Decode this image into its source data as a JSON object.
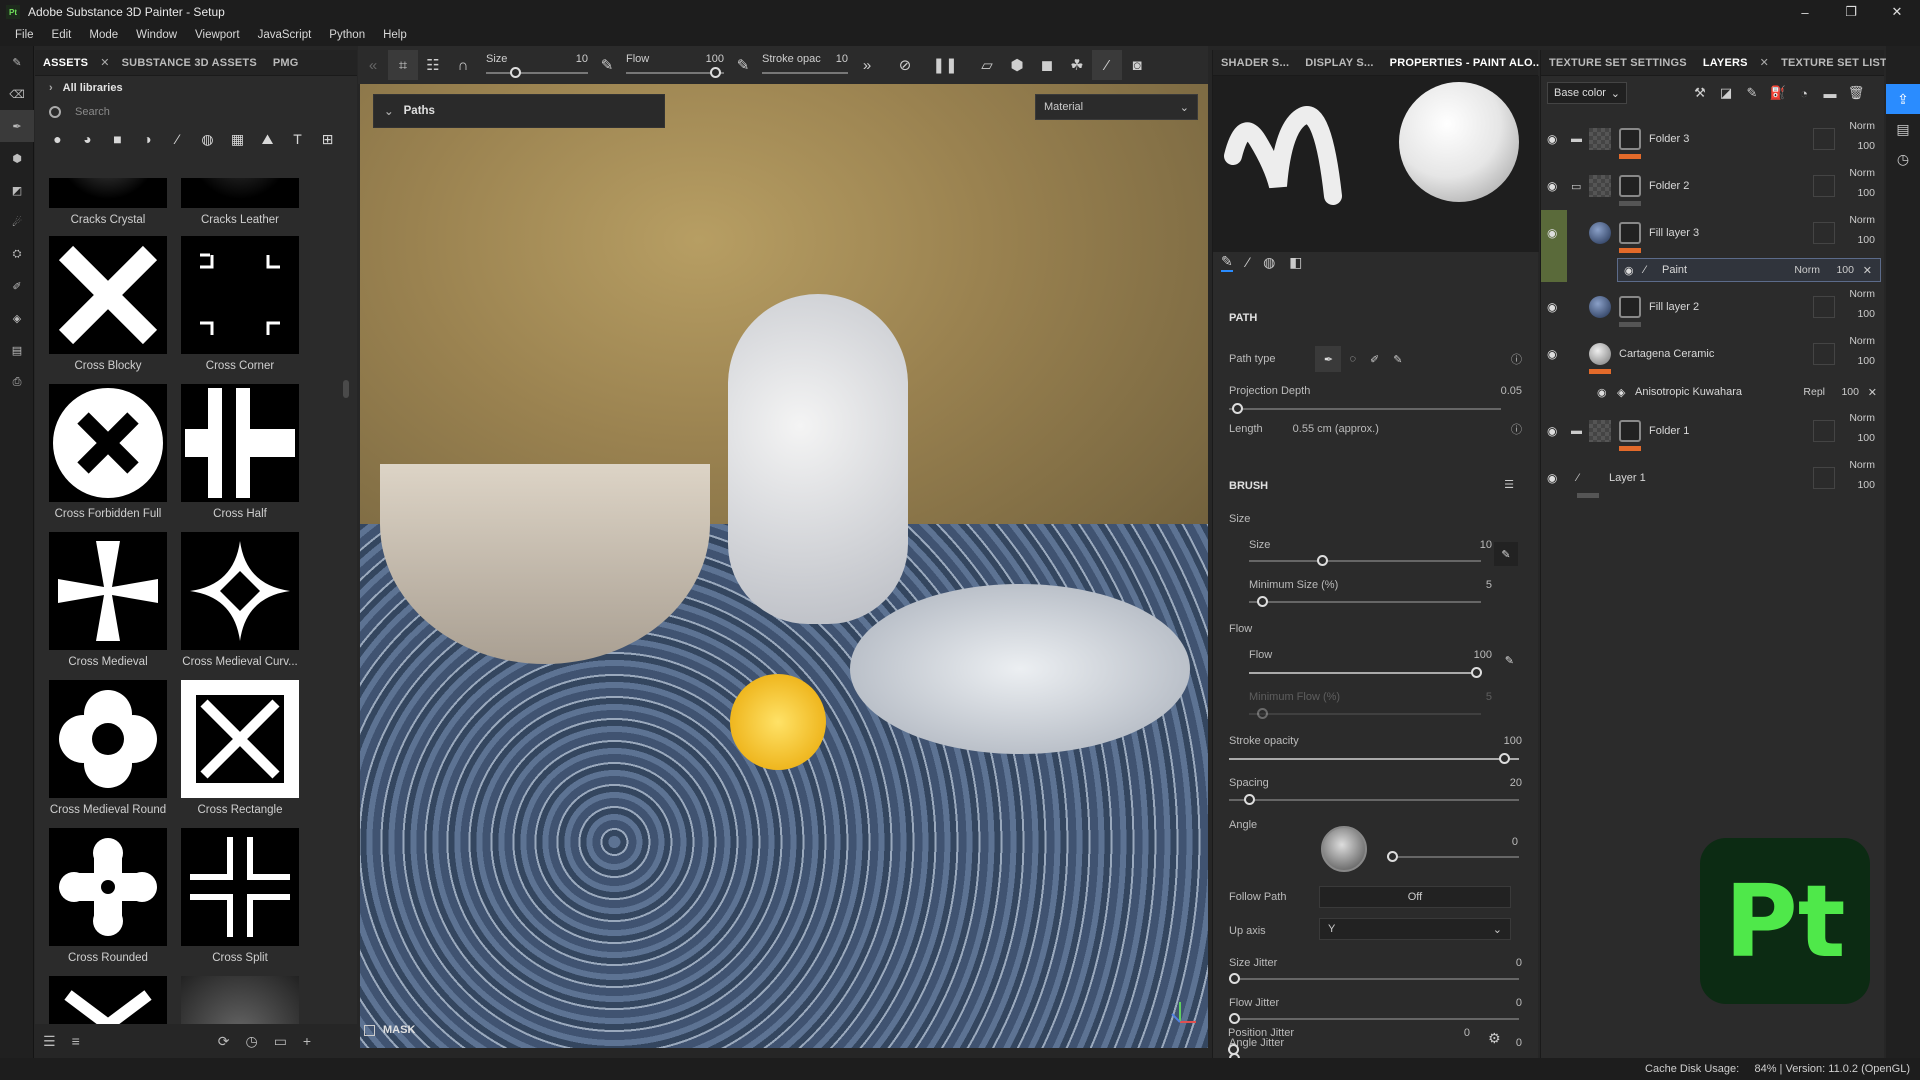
{
  "app": {
    "title": "Adobe Substance 3D Painter - Setup"
  },
  "window_controls": [
    "–",
    "❐",
    "✕"
  ],
  "menu": [
    "File",
    "Edit",
    "Mode",
    "Window",
    "Viewport",
    "JavaScript",
    "Python",
    "Help"
  ],
  "assets": {
    "tabs": [
      "ASSETS",
      "SUBSTANCE 3D ASSETS",
      "PMG"
    ],
    "library": "All libraries",
    "search_placeholder": "Search",
    "tiles": [
      {
        "label": "Cracks Crystal"
      },
      {
        "label": "Cracks Leather"
      },
      {
        "label": "Cross Blocky"
      },
      {
        "label": "Cross Corner"
      },
      {
        "label": "Cross Forbidden Full"
      },
      {
        "label": "Cross Half"
      },
      {
        "label": "Cross Medieval"
      },
      {
        "label": "Cross Medieval Curv..."
      },
      {
        "label": "Cross Medieval Round"
      },
      {
        "label": "Cross Rectangle"
      },
      {
        "label": "Cross Rounded"
      },
      {
        "label": "Cross Split"
      }
    ]
  },
  "viewport_toolbar": {
    "size": {
      "label": "Size",
      "value": "10"
    },
    "flow": {
      "label": "Flow",
      "value": "100"
    },
    "stroke": {
      "label": "Stroke opac",
      "value": "10"
    }
  },
  "viewport": {
    "paths_label": "Paths",
    "material_label": "Material",
    "mask_label": "MASK"
  },
  "properties": {
    "tabs": [
      "SHADER S...",
      "DISPLAY S...",
      "PROPERTIES - PAINT ALO..."
    ],
    "path_section": "PATH",
    "path_type_label": "Path type",
    "projection_depth": {
      "label": "Projection Depth",
      "value": "0.05",
      "fraction": 0.05
    },
    "length": {
      "label": "Length",
      "value": "0.55 cm (approx.)"
    },
    "brush_section": "BRUSH",
    "size_group": "Size",
    "size": {
      "label": "Size",
      "value": "10",
      "fraction": 0.32
    },
    "min_size": {
      "label": "Minimum Size (%)",
      "value": "5",
      "fraction": 0.05
    },
    "flow_group": "Flow",
    "flow": {
      "label": "Flow",
      "value": "100",
      "fraction": 1.0
    },
    "min_flow": {
      "label": "Minimum Flow (%)",
      "value": "5"
    },
    "stroke_opacity": {
      "label": "Stroke opacity",
      "value": "100",
      "fraction": 1.0
    },
    "spacing": {
      "label": "Spacing",
      "value": "20",
      "fraction": 0.06
    },
    "angle": {
      "label": "Angle",
      "value": "0"
    },
    "follow_path": {
      "label": "Follow Path",
      "value": "Off"
    },
    "up_axis": {
      "label": "Up axis",
      "value": "Y"
    },
    "size_jitter": {
      "label": "Size Jitter",
      "value": "0"
    },
    "flow_jitter": {
      "label": "Flow Jitter",
      "value": "0"
    },
    "angle_jitter": {
      "label": "Angle Jitter",
      "value": "0"
    },
    "position_jitter": {
      "label": "Position Jitter",
      "value": "0"
    }
  },
  "layers_panel": {
    "tabs": [
      "TEXTURE SET SETTINGS",
      "LAYERS",
      "TEXTURE SET LIST"
    ],
    "channel": "Base color",
    "layers": [
      {
        "name": "Folder 3",
        "blend": "Norm",
        "opacity": "100"
      },
      {
        "name": "Folder 2",
        "blend": "Norm",
        "opacity": "100"
      },
      {
        "name": "Fill layer 3",
        "blend": "Norm",
        "opacity": "100"
      },
      {
        "name": "Paint",
        "blend": "Norm",
        "opacity": "100"
      },
      {
        "name": "Fill layer 2",
        "blend": "Norm",
        "opacity": "100"
      },
      {
        "name": "Cartagena Ceramic",
        "blend": "Norm",
        "opacity": "100"
      },
      {
        "name": "Anisotropic Kuwahara",
        "blend": "Repl",
        "opacity": "100"
      },
      {
        "name": "Folder 1",
        "blend": "Norm",
        "opacity": "100"
      },
      {
        "name": "Layer 1",
        "blend": "Norm",
        "opacity": "100"
      }
    ]
  },
  "logo_text": "Pt",
  "status": "Cache Disk Usage:     84% | Version: 11.0.2 (OpenGL)",
  "colors": {
    "accent": "#e36a2a",
    "logo_bg": "#0c2b13",
    "logo_fg": "#4fe84a"
  }
}
